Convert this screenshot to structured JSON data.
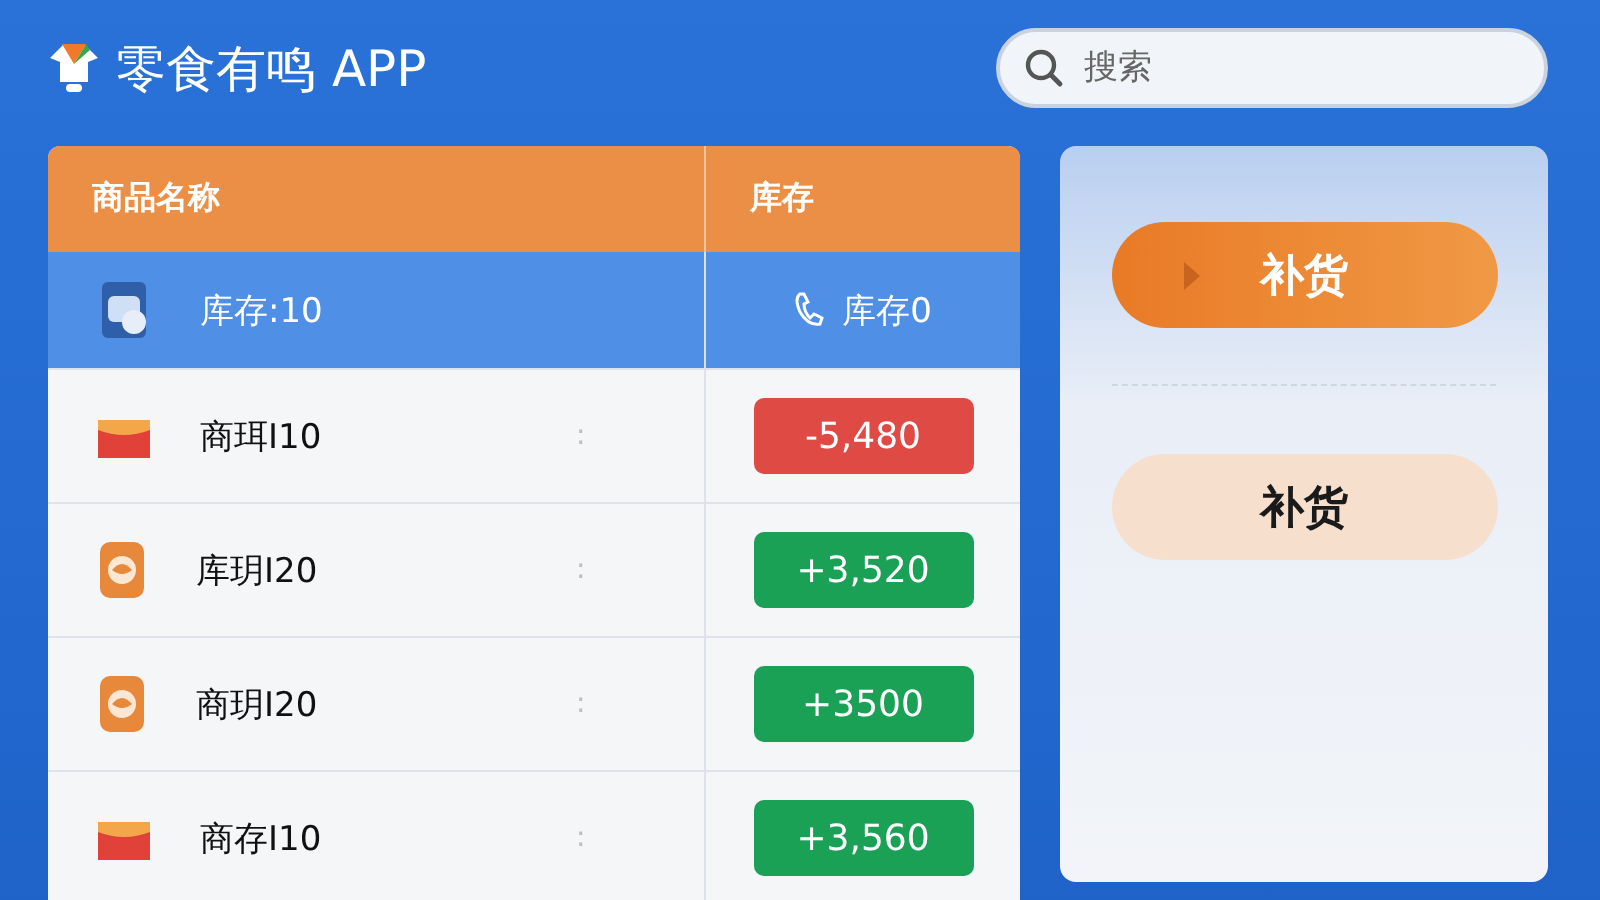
{
  "app": {
    "title": "零食有鸣 APP"
  },
  "search": {
    "placeholder": "搜索"
  },
  "table": {
    "columns": [
      "商品名称",
      "库存"
    ],
    "rows": [
      {
        "kind": "chips",
        "name": "库存:10",
        "mid": "",
        "stock": {
          "text": "库存0",
          "kind": "plain"
        },
        "selected": true
      },
      {
        "kind": "envelope",
        "name": "商珥I10",
        "mid": ":",
        "stock": {
          "text": "-5,480",
          "kind": "negative"
        },
        "selected": false
      },
      {
        "kind": "sack",
        "name": "库玥I20",
        "mid": ":",
        "stock": {
          "text": "+3,520",
          "kind": "positive"
        },
        "selected": false
      },
      {
        "kind": "sack",
        "name": "商玥I20",
        "mid": ":",
        "stock": {
          "text": "+3500",
          "kind": "positive"
        },
        "selected": false
      },
      {
        "kind": "envelope",
        "name": "商存I10",
        "mid": ":",
        "stock": {
          "text": "+3,560",
          "kind": "positive"
        },
        "selected": false
      }
    ]
  },
  "actions": [
    {
      "label": "补货",
      "primary": true
    },
    {
      "label": "补货",
      "primary": false
    }
  ]
}
